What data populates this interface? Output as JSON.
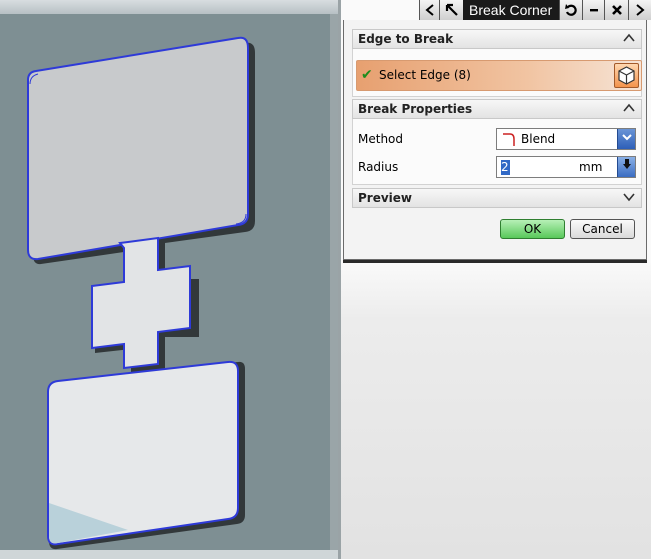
{
  "window": {
    "title": "Break Corner",
    "buttons": [
      "back",
      "select-arrow",
      "reset",
      "minimize",
      "close",
      "forward"
    ]
  },
  "dialog": {
    "edge_section": {
      "title": "Edge to Break",
      "select_label": "Select Edge (8)"
    },
    "properties_section": {
      "title": "Break Properties",
      "method_label": "Method",
      "method_value": "Blend",
      "radius_label": "Radius",
      "radius_value": "2",
      "radius_unit": "mm"
    },
    "preview_section": {
      "title": "Preview"
    },
    "ok_label": "OK",
    "cancel_label": "Cancel"
  },
  "colors": {
    "viewport_bg": "#7e8f93",
    "edge_highlight": "#2e3ad8",
    "select_row": "#e7a070",
    "ok_button": "#59c85a"
  }
}
